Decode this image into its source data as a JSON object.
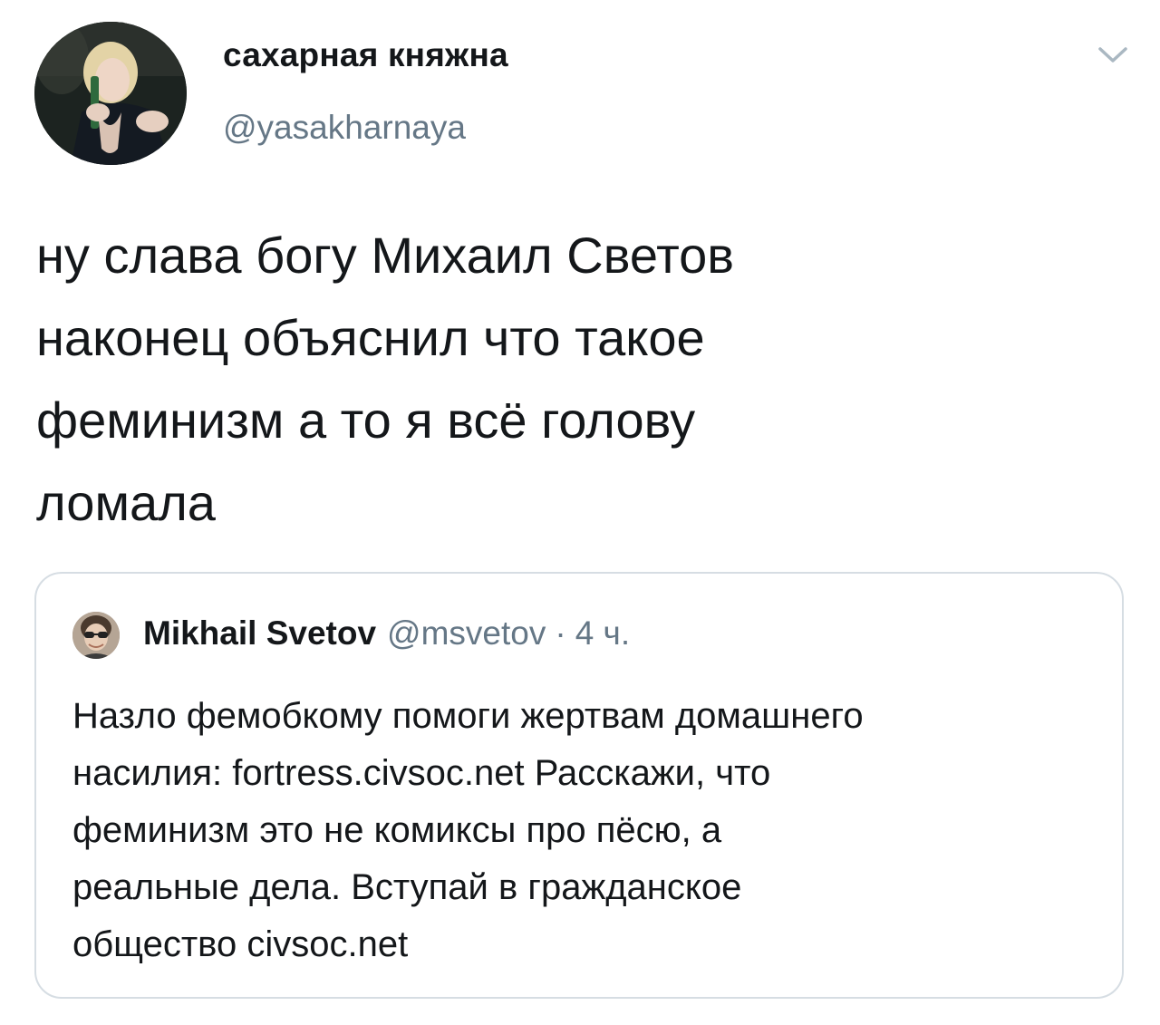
{
  "tweet": {
    "author": {
      "display_name": "сахарная княжна",
      "handle": "@yasakharnaya"
    },
    "text_lines": [
      "ну слава богу Михаил Светов",
      "наконец объяснил что такое",
      "феминизм а то я всё голову",
      "ломала"
    ],
    "menu_icon": "chevron-down-icon"
  },
  "quoted_tweet": {
    "author": {
      "display_name": "Mikhail Svetov",
      "handle": "@msvetov"
    },
    "separator": "·",
    "time": "4 ч.",
    "text_lines": [
      "Назло фемобкому помоги жертвам домашнего",
      "насилия: fortress.civsoc.net Расскажи, что",
      "феминизм это не комиксы про пёсю, а",
      "реальные дела. Вступай в гражданское",
      "общество civsoc.net"
    ]
  },
  "colors": {
    "text": "#14171a",
    "secondary": "#657786",
    "border": "#d6dde3",
    "caret": "#aab8c2"
  }
}
